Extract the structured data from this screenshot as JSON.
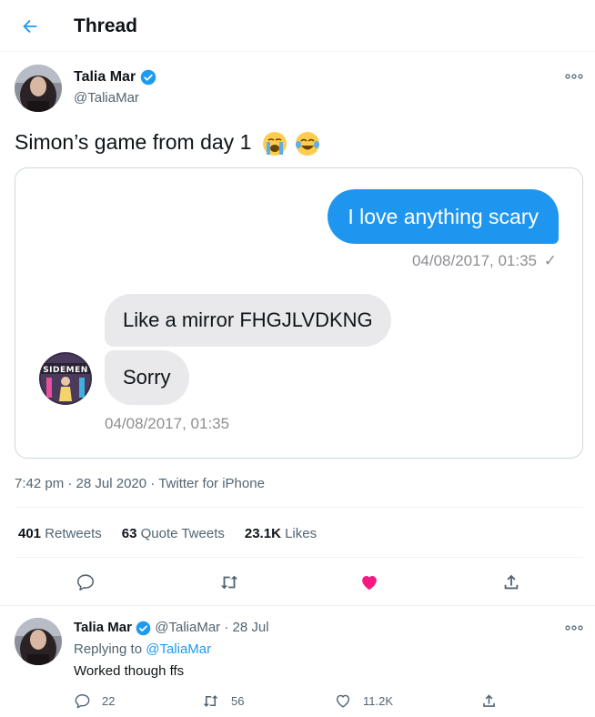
{
  "header": {
    "title": "Thread",
    "back_icon": "arrow-left-icon",
    "accent": "#1d9bf0"
  },
  "tweet": {
    "author_name": "Talia Mar",
    "author_handle": "@TaliaMar",
    "text": "Simon’s game from day 1",
    "emojis": [
      "loudly-crying-face",
      "face-with-tears-of-joy"
    ],
    "media": {
      "outgoing_message": "I love anything scary",
      "outgoing_time": "04/08/2017, 01:35",
      "outgoing_check": "✓",
      "incoming_messages": [
        "Like a mirror FHGJLVDKNG",
        "Sorry"
      ],
      "incoming_time": "04/08/2017, 01:35",
      "avatar_text": "SIDEMEN",
      "bubble_out_color": "#1e96f0",
      "bubble_in_color": "#e9e9eb"
    },
    "time": "7:42 pm",
    "date": "28 Jul 2020",
    "source": "Twitter for iPhone",
    "separator": "·",
    "stats": {
      "retweets_count": "401",
      "retweets_label": "Retweets",
      "quote_count": "63",
      "quote_label": "Quote Tweets",
      "likes_count": "23.1K",
      "likes_label": "Likes"
    },
    "liked": true,
    "like_color": "#f91880"
  },
  "reply": {
    "author_name": "Talia Mar",
    "author_handle": "@TaliaMar",
    "separator": "·",
    "date": "28 Jul",
    "replying_prefix": "Replying to",
    "replying_to": "@TaliaMar",
    "text": "Worked though ffs",
    "replies": "22",
    "retweets": "56",
    "likes": "11.2K"
  }
}
